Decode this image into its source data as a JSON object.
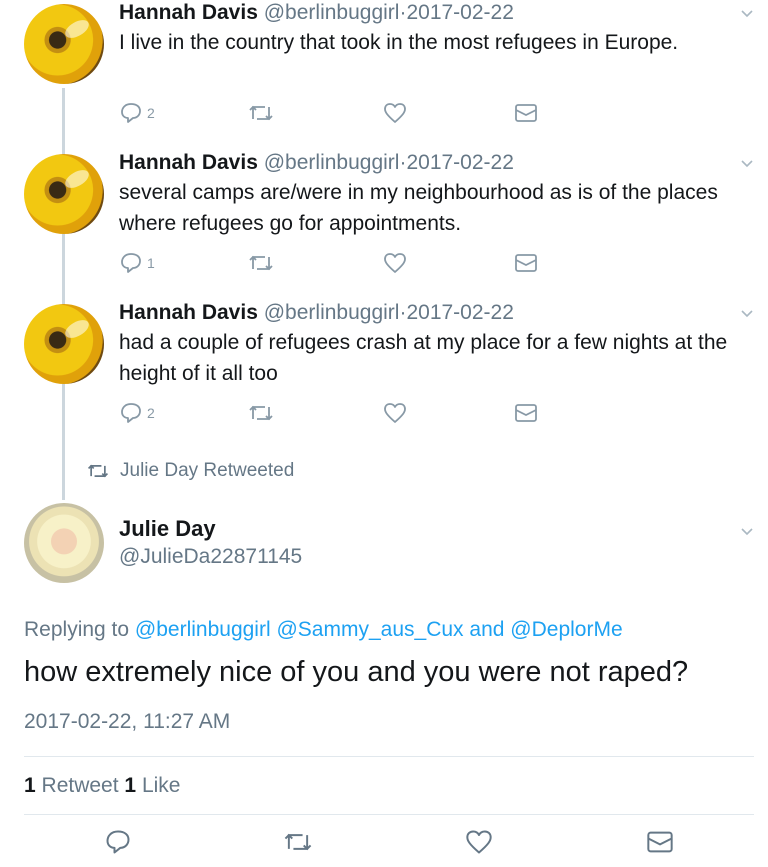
{
  "thread": [
    {
      "name": "Hannah Davis",
      "handle": "@berlinbuggirl",
      "separator": "·",
      "date": "2017-02-22",
      "text": "I live in the country that took in the most refugees in Europe.",
      "reply_count": "2"
    },
    {
      "name": "Hannah Davis",
      "handle": "@berlinbuggirl",
      "separator": "·",
      "date": "2017-02-22",
      "text": "several camps are/were in my neighbourhood as is of the places where refugees go for appointments.",
      "reply_count": "1"
    },
    {
      "name": "Hannah Davis",
      "handle": "@berlinbuggirl",
      "separator": "·",
      "date": "2017-02-22",
      "text": "had a couple of refugees crash at my place for a few nights at the height of it all too",
      "reply_count": "2"
    }
  ],
  "retweeted_label": "Julie Day Retweeted",
  "main": {
    "name": "Julie Day",
    "handle": "@JulieDa22871145",
    "replying_prefix": "Replying to",
    "replying_handle_1": "@berlinbuggirl",
    "replying_handle_2": "@Sammy_aus_Cux",
    "replying_and": "and",
    "replying_handle_3": "@DeplorMe",
    "text": "how extremely nice of you and you were not raped?",
    "timestamp": "2017-02-22, 11:27 AM",
    "retweet_count": "1",
    "retweet_label": "Retweet",
    "like_count": "1",
    "like_label": "Like"
  },
  "icons": {
    "reply": "reply-icon",
    "retweet": "retweet-icon",
    "like": "heart-icon",
    "dm": "envelope-icon",
    "caret": "chevron-down-icon"
  },
  "colors": {
    "link": "#1da1f2",
    "secondary_text": "#657786",
    "action_icon": "#8899a6"
  }
}
